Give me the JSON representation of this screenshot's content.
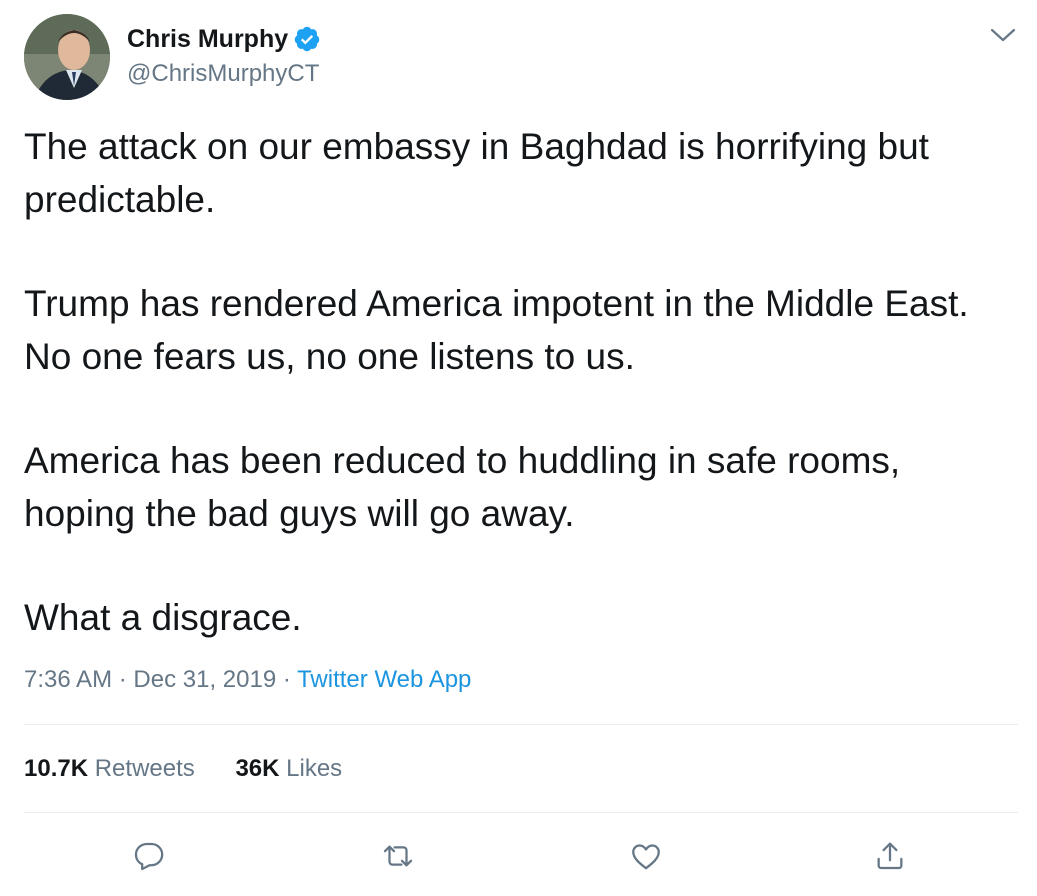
{
  "author": {
    "display_name": "Chris Murphy",
    "handle": "@ChrisMurphyCT",
    "verified": true
  },
  "tweet": {
    "paragraphs": [
      "The attack on our embassy in Baghdad is horrifying but predictable.",
      "Trump has rendered America impotent in the Middle East. No one fears us, no one listens to us.",
      "America has been reduced to huddling in safe rooms, hoping the bad guys will go away.",
      "What a disgrace."
    ]
  },
  "meta": {
    "time": "7:36 AM",
    "date": "Dec 31, 2019",
    "separator": "·",
    "source": "Twitter Web App"
  },
  "stats": {
    "retweets_count": "10.7K",
    "retweets_label": "Retweets",
    "likes_count": "36K",
    "likes_label": "Likes"
  },
  "actions": [
    {
      "icon": "reply-icon"
    },
    {
      "icon": "retweet-icon"
    },
    {
      "icon": "like-icon"
    },
    {
      "icon": "share-icon"
    }
  ],
  "colors": {
    "text": "#14171a",
    "secondary": "#657786",
    "link": "#1b95e0",
    "verified_badge": "#1da1f2",
    "divider": "#e6ecf0"
  }
}
